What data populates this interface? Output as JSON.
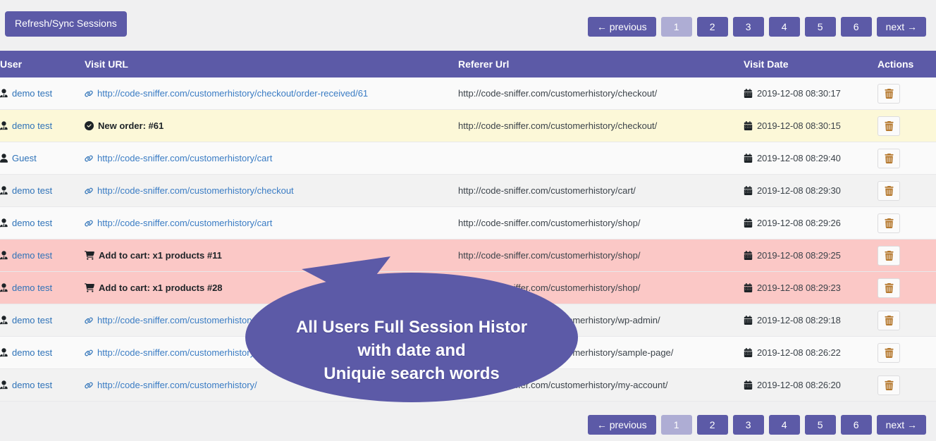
{
  "colors": {
    "brand": "#5c5aa7",
    "brand_active": "#aeadd4",
    "page_bg": "#f0f0f1",
    "row_order_bg": "#fcf8d8",
    "row_cart_bg": "#fbc8c6",
    "link": "#3a7cc4",
    "trash": "#b4762a"
  },
  "toolbar": {
    "refresh_label": "Refresh/Sync Sessions"
  },
  "pagination": {
    "previous_label": "← previous",
    "next_label": "next →",
    "pages": [
      "1",
      "2",
      "3",
      "4",
      "5",
      "6"
    ],
    "current_page": "1"
  },
  "table": {
    "columns": {
      "user": "User",
      "visit_url": "Visit URL",
      "referer_url": "Referer Url",
      "visit_date": "Visit Date",
      "actions": "Actions"
    },
    "rows": [
      {
        "user": "demo test",
        "user_icon": "user-tie-icon",
        "visit_type": "link",
        "visit_icon": "link-icon",
        "visit_url": "http://code-sniffer.com/customerhistory/checkout/order-received/61",
        "referer_url": "http://code-sniffer.com/customerhistory/checkout/",
        "visit_date": "2019-12-08 08:30:17",
        "row_style": "odd"
      },
      {
        "user": "demo test",
        "user_icon": "user-tie-icon",
        "visit_type": "event",
        "visit_icon": "check-circle-icon",
        "visit_url": "New order: #61",
        "referer_url": "http://code-sniffer.com/customerhistory/checkout/",
        "visit_date": "2019-12-08 08:30:15",
        "row_style": "order"
      },
      {
        "user": "Guest",
        "user_icon": "user-icon",
        "visit_type": "link",
        "visit_icon": "link-icon",
        "visit_url": "http://code-sniffer.com/customerhistory/cart",
        "referer_url": "",
        "visit_date": "2019-12-08 08:29:40",
        "row_style": "odd"
      },
      {
        "user": "demo test",
        "user_icon": "user-tie-icon",
        "visit_type": "link",
        "visit_icon": "link-icon",
        "visit_url": "http://code-sniffer.com/customerhistory/checkout",
        "referer_url": "http://code-sniffer.com/customerhistory/cart/",
        "visit_date": "2019-12-08 08:29:30",
        "row_style": "even"
      },
      {
        "user": "demo test",
        "user_icon": "user-tie-icon",
        "visit_type": "link",
        "visit_icon": "link-icon",
        "visit_url": "http://code-sniffer.com/customerhistory/cart",
        "referer_url": "http://code-sniffer.com/customerhistory/shop/",
        "visit_date": "2019-12-08 08:29:26",
        "row_style": "odd"
      },
      {
        "user": "demo test",
        "user_icon": "user-tie-icon",
        "visit_type": "event",
        "visit_icon": "shopping-cart-icon",
        "visit_url": "Add to cart: x1 products #11",
        "referer_url": "http://code-sniffer.com/customerhistory/shop/",
        "visit_date": "2019-12-08 08:29:25",
        "row_style": "cart"
      },
      {
        "user": "demo test",
        "user_icon": "user-tie-icon",
        "visit_type": "event",
        "visit_icon": "shopping-cart-icon",
        "visit_url": "Add to cart: x1 products #28",
        "referer_url": "http://code-sniffer.com/customerhistory/shop/",
        "visit_date": "2019-12-08 08:29:23",
        "row_style": "cart"
      },
      {
        "user": "demo test",
        "user_icon": "user-tie-icon",
        "visit_type": "link",
        "visit_icon": "link-icon",
        "visit_url": "http://code-sniffer.com/customerhistory/shop",
        "referer_url": "http://code-sniffer.com/customerhistory/wp-admin/",
        "visit_date": "2019-12-08 08:29:18",
        "row_style": "even"
      },
      {
        "user": "demo test",
        "user_icon": "user-tie-icon",
        "visit_type": "link",
        "visit_icon": "link-icon",
        "visit_url": "http://code-sniffer.com/customerhistory/",
        "referer_url": "http://code-sniffer.com/customerhistory/sample-page/",
        "visit_date": "2019-12-08 08:26:22",
        "row_style": "odd"
      },
      {
        "user": "demo test",
        "user_icon": "user-tie-icon",
        "visit_type": "link",
        "visit_icon": "link-icon",
        "visit_url": "http://code-sniffer.com/customerhistory/",
        "referer_url": "http://code-sniffer.com/customerhistory/my-account/",
        "visit_date": "2019-12-08 08:26:20",
        "row_style": "even"
      }
    ],
    "delete_icon": "trash-icon"
  },
  "callout": {
    "line1": "All Users Full Session Histor",
    "line2": "with date and",
    "line3": "Uniquie search words"
  }
}
